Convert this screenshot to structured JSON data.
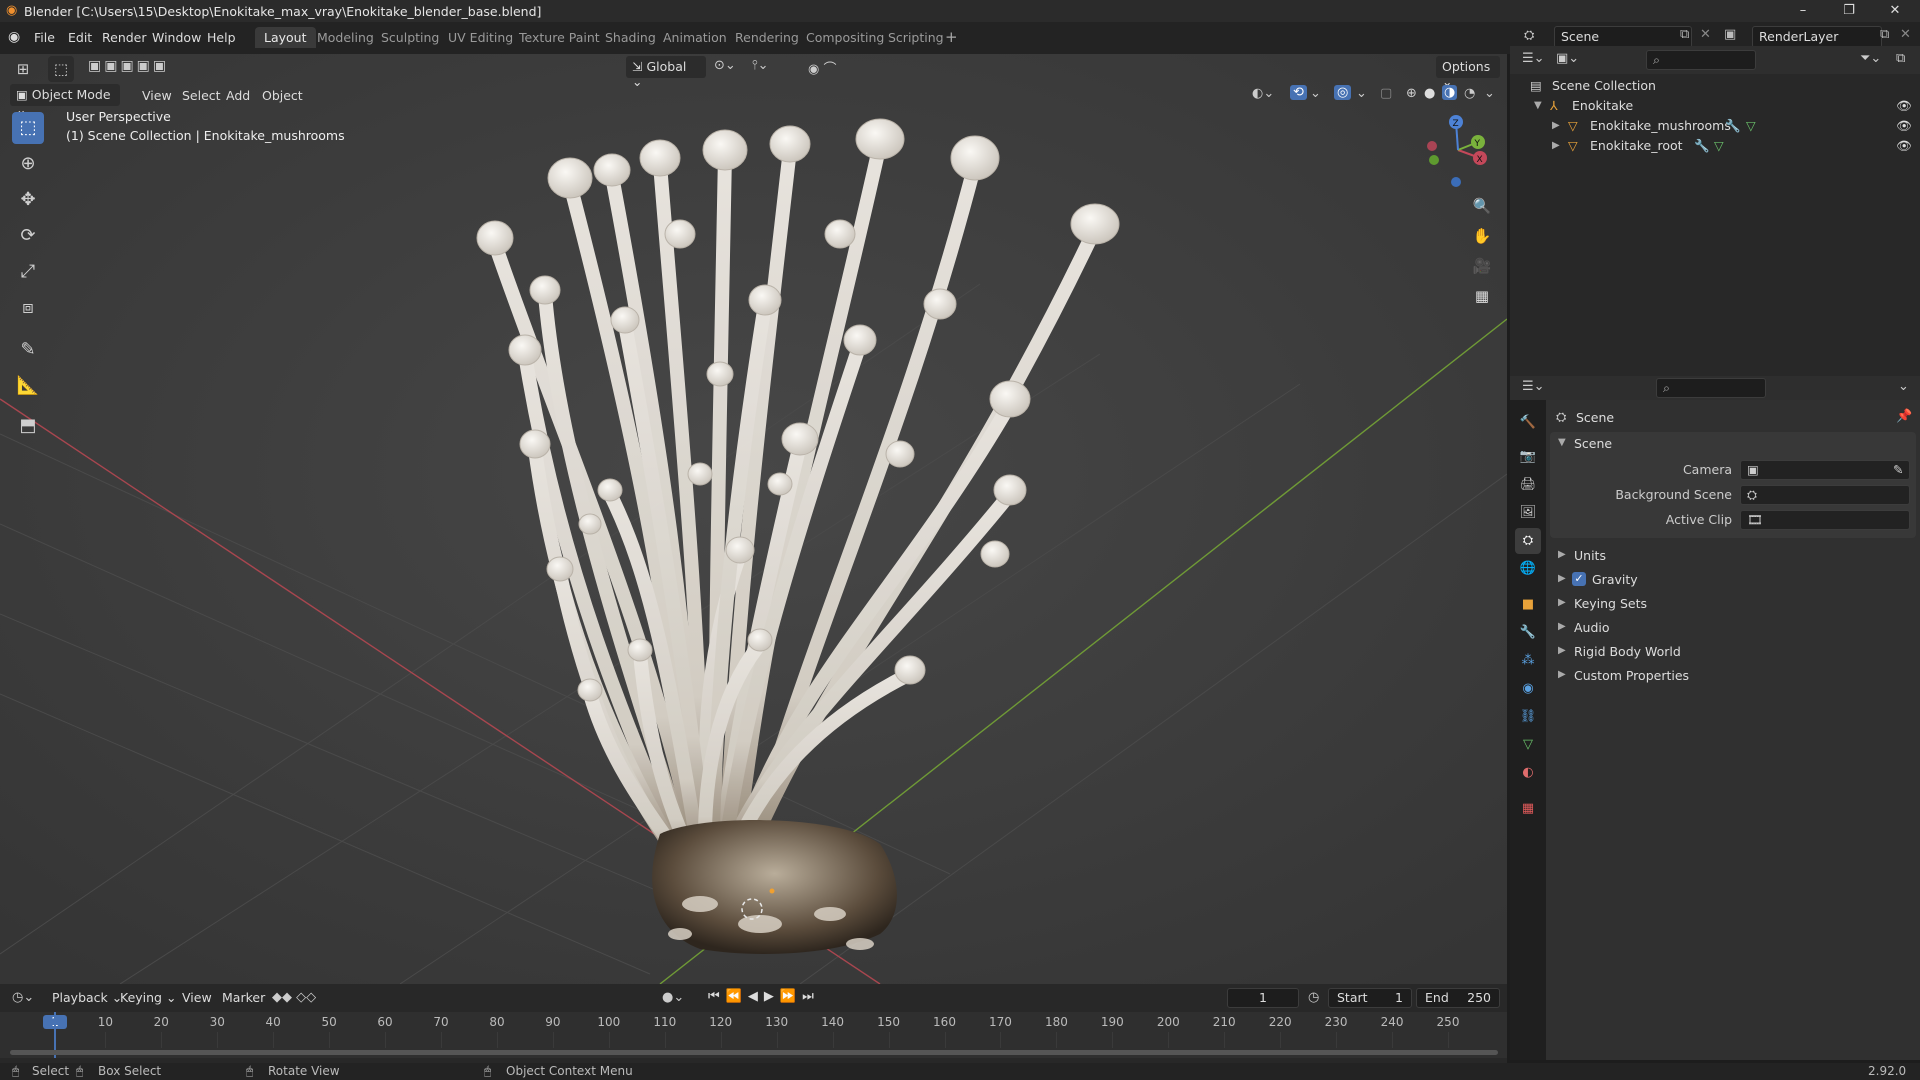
{
  "window": {
    "title": "Blender [C:\\Users\\15\\Desktop\\Enokitake_max_vray\\Enokitake_blender_base.blend]",
    "controls": [
      "–",
      "❐",
      "✕"
    ]
  },
  "menu": [
    "File",
    "Edit",
    "Render",
    "Window",
    "Help"
  ],
  "workspace_tabs": [
    {
      "label": "Layout",
      "active": true
    },
    {
      "label": "Modeling"
    },
    {
      "label": "Sculpting"
    },
    {
      "label": "UV Editing"
    },
    {
      "label": "Texture Paint"
    },
    {
      "label": "Shading"
    },
    {
      "label": "Animation"
    },
    {
      "label": "Rendering"
    },
    {
      "label": "Compositing"
    },
    {
      "label": "Scripting"
    }
  ],
  "scene_selector": {
    "value": "Scene"
  },
  "render_layer": {
    "value": "RenderLayer"
  },
  "viewport": {
    "transform_orientation": "Global",
    "options_label": "Options",
    "mode": "Object Mode",
    "header_menu": [
      "View",
      "Select",
      "Add",
      "Object"
    ],
    "overlay_line1": "User Perspective",
    "overlay_line2": "(1) Scene Collection | Enokitake_mushrooms",
    "gizmo_axes": [
      "X",
      "Y",
      "Z"
    ]
  },
  "outliner": {
    "root": "Scene Collection",
    "items": [
      {
        "label": "Enokitake",
        "level": 1
      },
      {
        "label": "Enokitake_mushrooms",
        "level": 2
      },
      {
        "label": "Enokitake_root",
        "level": 2
      }
    ]
  },
  "properties": {
    "context": "Scene",
    "panel_title": "Scene",
    "fields": [
      {
        "label": "Camera",
        "value": ""
      },
      {
        "label": "Background Scene",
        "value": ""
      },
      {
        "label": "Active Clip",
        "value": ""
      }
    ],
    "sections": [
      {
        "label": "Units"
      },
      {
        "label": "Gravity",
        "checked": true
      },
      {
        "label": "Keying Sets"
      },
      {
        "label": "Audio"
      },
      {
        "label": "Rigid Body World"
      },
      {
        "label": "Custom Properties"
      }
    ],
    "tab_colors": [
      "#cccccc",
      "#cccccc",
      "#cccccc",
      "#cccccc",
      "#cccccc",
      "#e06c6c",
      "#e8a23a",
      "#5aa0e0",
      "#5aa0e0",
      "#5aa0e0",
      "#5aa0e0",
      "#6ac06a",
      "#e06c6c",
      "#e05a5a"
    ]
  },
  "timeline": {
    "menu": [
      "Playback",
      "Keying",
      "View",
      "Marker"
    ],
    "current_frame": "1",
    "start_label": "Start",
    "start_value": "1",
    "end_label": "End",
    "end_value": "250",
    "ticks": [
      "1",
      "10",
      "20",
      "30",
      "40",
      "50",
      "60",
      "70",
      "80",
      "90",
      "100",
      "110",
      "120",
      "130",
      "140",
      "150",
      "160",
      "170",
      "180",
      "190",
      "200",
      "210",
      "220",
      "230",
      "240",
      "250"
    ]
  },
  "status": {
    "select": "Select",
    "box_select": "Box Select",
    "rotate_view": "Rotate View",
    "context_menu": "Object Context Menu",
    "version": "2.92.0"
  },
  "colors": {
    "accent": "#4772b3",
    "x_axis": "#c4485a",
    "y_axis": "#7ab23c",
    "z_axis": "#4d82d6"
  }
}
